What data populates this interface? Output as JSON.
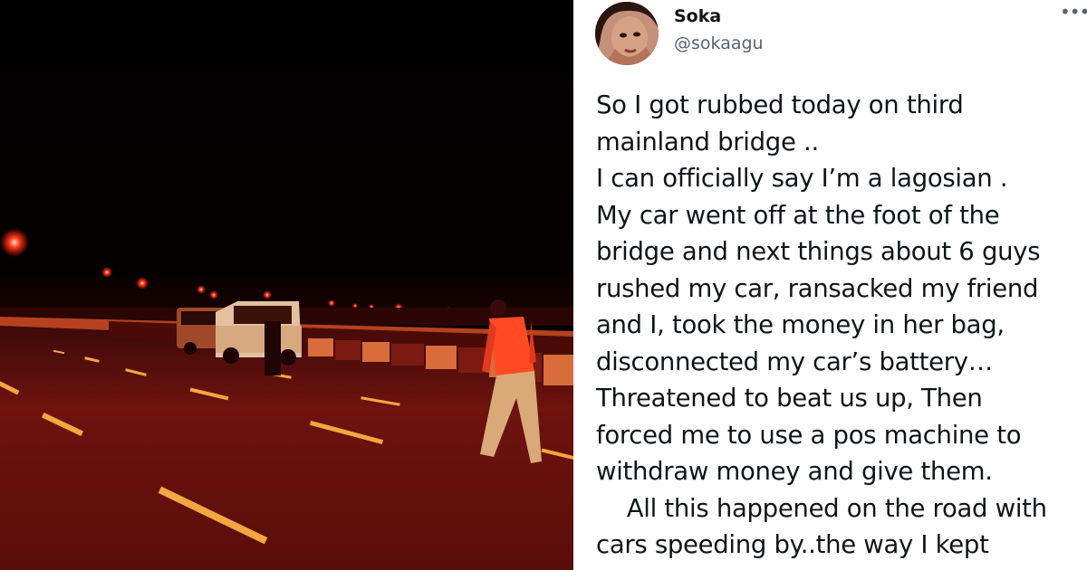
{
  "tweet": {
    "author_name": "Soka",
    "author_handle": "@sokaagu",
    "more_icon": "ellipsis-icon",
    "lines": [
      "So I got rubbed today on third",
      "mainland bridge ..",
      "I can officially say I’m a  lagosian .",
      "My car went off at the foot of the",
      "bridge and next things about 6 guys",
      "rushed my car, ransacked my friend",
      "and I, took the money in her bag,",
      "disconnected my car’s battery…",
      "Threatened to beat us up, Then",
      "forced me to use a pos machine to",
      "withdraw money and give them.",
      "    All this happened on the road with",
      "cars speeding by..the way I kept"
    ]
  },
  "colors": {
    "text_primary": "#0f1419",
    "text_secondary": "#536471",
    "photo_glow": "#d2231b"
  }
}
